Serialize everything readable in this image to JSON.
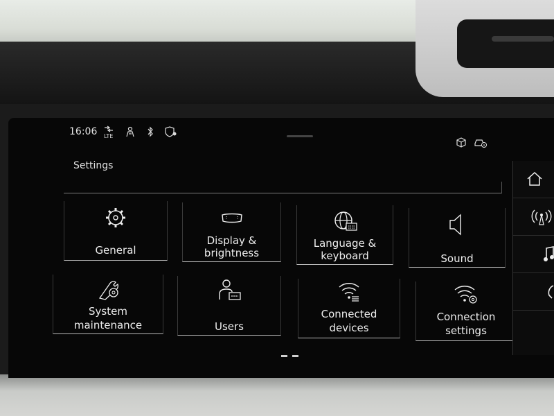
{
  "status_bar": {
    "time": "16:06",
    "network_label": "LTE",
    "icons": [
      "lte-signal-icon",
      "profile-icon",
      "bluetooth-icon",
      "navigation-shield-icon",
      "car-package-icon",
      "vehicle-info-icon"
    ]
  },
  "settings": {
    "title": "Settings",
    "tiles": [
      {
        "id": "general",
        "line1": "General",
        "line2": "",
        "icon": "gear-icon"
      },
      {
        "id": "display",
        "line1": "Display &",
        "line2": "brightness",
        "icon": "display-icon"
      },
      {
        "id": "language",
        "line1": "Language &",
        "line2": "keyboard",
        "icon": "globe-keyboard-icon"
      },
      {
        "id": "sound",
        "line1": "Sound",
        "line2": "",
        "icon": "speaker-icon"
      },
      {
        "id": "system",
        "line1": "System",
        "line2": "maintenance",
        "icon": "wrench-gear-icon"
      },
      {
        "id": "users",
        "line1": "Users",
        "line2": "",
        "icon": "user-icon"
      },
      {
        "id": "connected",
        "line1": "Connected",
        "line2": "devices",
        "icon": "wifi-list-icon"
      },
      {
        "id": "connection",
        "line1": "Connection",
        "line2": "settings",
        "icon": "wifi-gear-icon"
      }
    ]
  },
  "rail": {
    "items": [
      "home-icon",
      "radio-icon",
      "music-note-icon",
      "phone-icon"
    ]
  },
  "colors": {
    "screen_bg": "#070707",
    "text": "#eeeeee",
    "tile_border": "#b9b9b9"
  }
}
